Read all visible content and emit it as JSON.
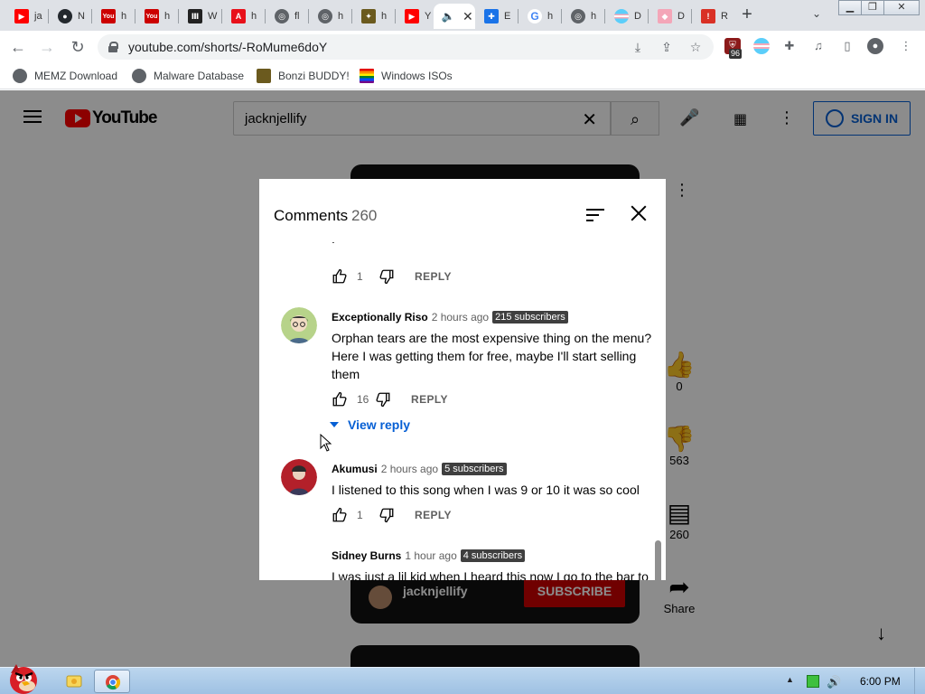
{
  "browser": {
    "tabs": [
      {
        "title": "ja",
        "icon": "youtube-icon",
        "color": "#ff0000"
      },
      {
        "title": "N",
        "icon": "github-icon",
        "color": "#24292e"
      },
      {
        "title": "h",
        "icon": "youtube-classic-icon",
        "color": "#cc0000"
      },
      {
        "title": "h",
        "icon": "youtube-classic-icon",
        "color": "#cc0000"
      },
      {
        "title": "W",
        "icon": "wayback-icon",
        "color": "#222222"
      },
      {
        "title": "h",
        "icon": "adobe-icon",
        "color": "#e8101a"
      },
      {
        "title": "fl",
        "icon": "globe-icon",
        "color": "#5f6368"
      },
      {
        "title": "h",
        "icon": "globe-icon",
        "color": "#5f6368"
      },
      {
        "title": "h",
        "icon": "bonzi-icon",
        "color": "#6b5a1e"
      },
      {
        "title": "Y",
        "icon": "youtube-icon",
        "color": "#ff0000"
      },
      {
        "title": "",
        "icon": "speaker-icon",
        "color": "#333333",
        "active": true
      },
      {
        "title": "E",
        "icon": "puzzle-icon",
        "color": "#1a73e8"
      },
      {
        "title": "h",
        "icon": "google-icon",
        "color": "#4285f4"
      },
      {
        "title": "h",
        "icon": "globe-icon",
        "color": "#5f6368"
      },
      {
        "title": "D",
        "icon": "flag-icon",
        "color": "#5bcefa"
      },
      {
        "title": "D",
        "icon": "cake-icon",
        "color": "#f4a6b8"
      },
      {
        "title": "R",
        "icon": "alert-icon",
        "color": "#d93025"
      }
    ],
    "new_tab": "+",
    "url": "youtube.com/shorts/-RoMume6doY",
    "extension_badge": "96",
    "bookmarks": [
      {
        "label": "MEMZ Download"
      },
      {
        "label": "Malware Database"
      },
      {
        "label": "Bonzi BUDDY!"
      },
      {
        "label": "Windows ISOs"
      }
    ]
  },
  "youtube": {
    "logo": "YouTube",
    "search_query": "jacknjellify",
    "signin": "SIGN IN",
    "channel": "jacknjellify",
    "subscribe": "SUBSCRIBE",
    "rail": {
      "likes": "0",
      "dislikes": "563",
      "comments": "260",
      "share": "Share"
    }
  },
  "comments_panel": {
    "title": "Comments",
    "count": "260",
    "comments": [
      {
        "partial": true,
        "likes": "1",
        "reply": "REPLY"
      },
      {
        "author": "Exceptionally Riso",
        "time": "2 hours ago",
        "subs": "215 subscribers",
        "text": "Orphan tears are the most expensive thing on the menu? Here I was getting them for free, maybe I'll start selling them",
        "likes": "16",
        "reply": "REPLY",
        "view_reply": "View reply"
      },
      {
        "author": "Akumusi",
        "time": "2 hours ago",
        "subs": "5 subscribers",
        "text": "I listened to this song when I was 9 or 10 it was so cool",
        "likes": "1",
        "reply": "REPLY"
      },
      {
        "author": "Sidney Burns",
        "time": "1 hour ago",
        "subs": "4 subscribers",
        "text": "I was just a lil kid when I heard this now I go to the bar to"
      }
    ]
  },
  "taskbar": {
    "time": "6:00 PM"
  }
}
